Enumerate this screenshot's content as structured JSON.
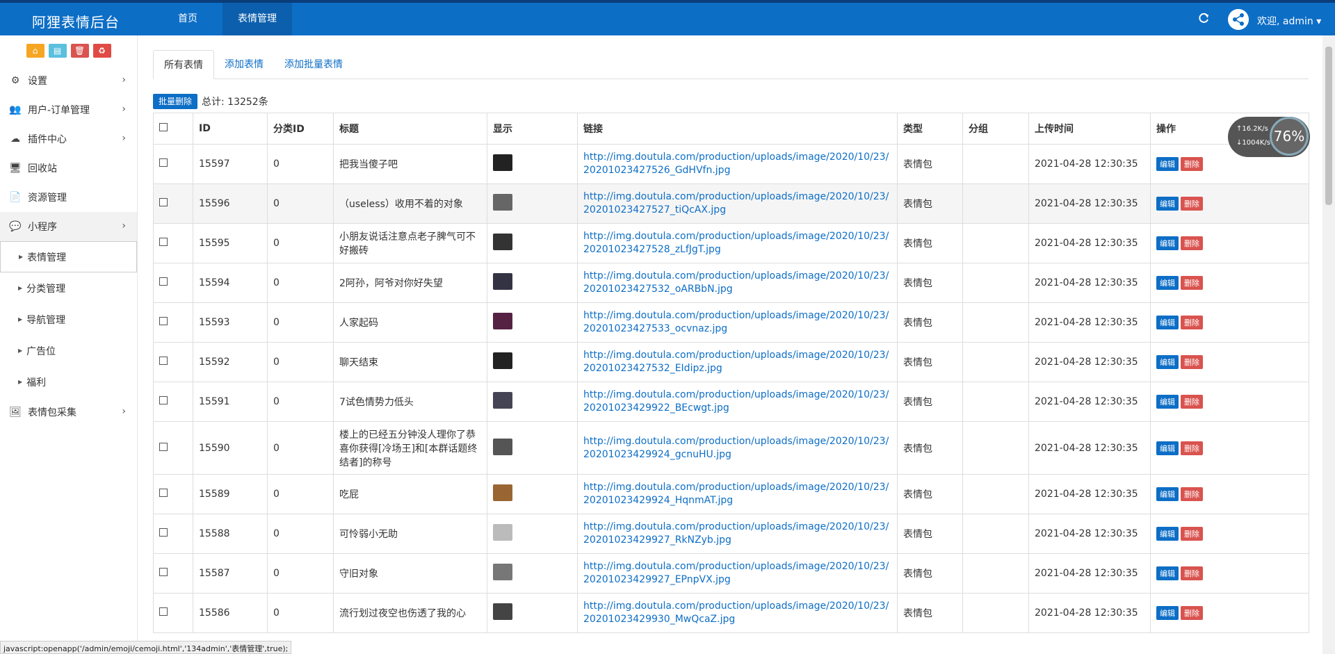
{
  "app": {
    "brand": "阿狸表情后台",
    "nav": [
      "首页",
      "表情管理"
    ],
    "active_nav": 1,
    "welcome": "欢迎, admin ▾"
  },
  "colors": {
    "primary": "#0d6ec6",
    "danger": "#d9534f",
    "warning": "#f6a623",
    "info": "#5bc0de"
  },
  "sidebar": {
    "quick_buttons": [
      "home-icon",
      "file-icon",
      "trash-icon",
      "recycle-icon"
    ],
    "items": [
      {
        "label": "设置",
        "icon": "gears-icon",
        "has_children": true
      },
      {
        "label": "用户-订单管理",
        "icon": "users-icon",
        "has_children": true
      },
      {
        "label": "插件中心",
        "icon": "cloud-icon",
        "has_children": true
      },
      {
        "label": "回收站",
        "icon": "monitor-icon",
        "has_children": false
      },
      {
        "label": "资源管理",
        "icon": "file-icon",
        "has_children": false
      },
      {
        "label": "小程序",
        "icon": "wechat-icon",
        "has_children": true,
        "open": true
      }
    ],
    "sub_items": [
      "表情管理",
      "分类管理",
      "导航管理",
      "广告位",
      "福利"
    ],
    "active_sub": 0,
    "last_item": {
      "label": "表情包采集",
      "icon": "image-icon",
      "has_children": true
    }
  },
  "tabs": [
    "所有表情",
    "添加表情",
    "添加批量表情"
  ],
  "active_tab": 0,
  "toolbar": {
    "batch_delete": "批量删除",
    "total": "总计: 13252条"
  },
  "table": {
    "columns": [
      "",
      "ID",
      "分类ID",
      "标题",
      "显示",
      "链接",
      "类型",
      "分组",
      "上传时间",
      "操作"
    ],
    "edit_label": "编辑",
    "delete_label": "删除",
    "rows": [
      {
        "id": "15597",
        "cat": "0",
        "title": "把我当傻子吧",
        "link": "http://img.doutula.com/production/uploads/image/2020/10/23/20201023427526_GdHVfn.jpg",
        "type": "表情包",
        "group": "",
        "time": "2021-04-28 12:30:35"
      },
      {
        "id": "15596",
        "cat": "0",
        "title": "（useless）收用不着的对象",
        "link": "http://img.doutula.com/production/uploads/image/2020/10/23/20201023427527_tiQcAX.jpg",
        "type": "表情包",
        "group": "",
        "time": "2021-04-28 12:30:35"
      },
      {
        "id": "15595",
        "cat": "0",
        "title": "小朋友说话注意点老子脾气可不好搬砖",
        "link": "http://img.doutula.com/production/uploads/image/2020/10/23/20201023427528_zLfJgT.jpg",
        "type": "表情包",
        "group": "",
        "time": "2021-04-28 12:30:35"
      },
      {
        "id": "15594",
        "cat": "0",
        "title": "2阿孙，阿爷对你好失望",
        "link": "http://img.doutula.com/production/uploads/image/2020/10/23/20201023427532_oARBbN.jpg",
        "type": "表情包",
        "group": "",
        "time": "2021-04-28 12:30:35"
      },
      {
        "id": "15593",
        "cat": "0",
        "title": "人家起码",
        "link": "http://img.doutula.com/production/uploads/image/2020/10/23/20201023427533_ocvnaz.jpg",
        "type": "表情包",
        "group": "",
        "time": "2021-04-28 12:30:35"
      },
      {
        "id": "15592",
        "cat": "0",
        "title": "聊天结束",
        "link": "http://img.doutula.com/production/uploads/image/2020/10/23/20201023427532_EIdipz.jpg",
        "type": "表情包",
        "group": "",
        "time": "2021-04-28 12:30:35"
      },
      {
        "id": "15591",
        "cat": "0",
        "title": "7试色情势力低头",
        "link": "http://img.doutula.com/production/uploads/image/2020/10/23/20201023429922_BEcwgt.jpg",
        "type": "表情包",
        "group": "",
        "time": "2021-04-28 12:30:35"
      },
      {
        "id": "15590",
        "cat": "0",
        "title": "楼上的已经五分钟没人理你了恭喜你获得[冷场王]和[本群话题终结者]的称号",
        "link": "http://img.doutula.com/production/uploads/image/2020/10/23/20201023429924_gcnuHU.jpg",
        "type": "表情包",
        "group": "",
        "time": "2021-04-28 12:30:35"
      },
      {
        "id": "15589",
        "cat": "0",
        "title": "吃屁",
        "link": "http://img.doutula.com/production/uploads/image/2020/10/23/20201023429924_HqnmAT.jpg",
        "type": "表情包",
        "group": "",
        "time": "2021-04-28 12:30:35"
      },
      {
        "id": "15588",
        "cat": "0",
        "title": "可怜弱小无助",
        "link": "http://img.doutula.com/production/uploads/image/2020/10/23/20201023429927_RkNZyb.jpg",
        "type": "表情包",
        "group": "",
        "time": "2021-04-28 12:30:35"
      },
      {
        "id": "15587",
        "cat": "0",
        "title": "守旧对象",
        "link": "http://img.doutula.com/production/uploads/image/2020/10/23/20201023429927_EPnpVX.jpg",
        "type": "表情包",
        "group": "",
        "time": "2021-04-28 12:30:35"
      },
      {
        "id": "15586",
        "cat": "0",
        "title": "流行划过夜空也伤透了我的心",
        "link": "http://img.doutula.com/production/uploads/image/2020/10/23/20201023429930_MwQcaZ.jpg",
        "type": "表情包",
        "group": "",
        "time": "2021-04-28 12:30:35"
      }
    ]
  },
  "speed_widget": {
    "up": "↑16.2K/s",
    "down": "↓1004K/s",
    "percent": "76%"
  },
  "statusbar": "javascript:openapp('/admin/emoji/cemoji.html','134admin','表情管理',true);"
}
